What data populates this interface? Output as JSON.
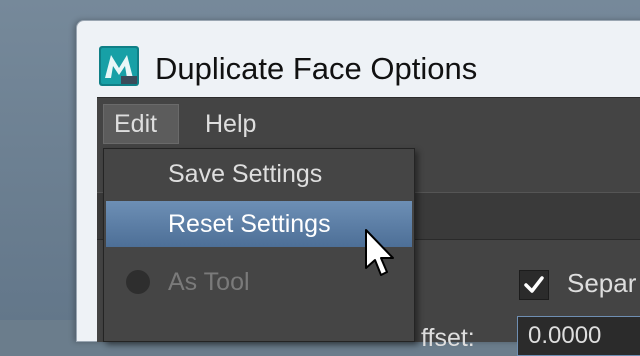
{
  "window": {
    "title": "Duplicate Face Options"
  },
  "menubar": {
    "items": [
      {
        "label": "Edit"
      },
      {
        "label": "Help"
      }
    ]
  },
  "edit_menu": {
    "items": [
      {
        "label": "Save Settings",
        "state": "normal"
      },
      {
        "label": "Reset Settings",
        "state": "highlighted"
      },
      {
        "label": "As Tool",
        "state": "disabled"
      }
    ]
  },
  "options": {
    "separate_label": "Separ",
    "separate_checked": true,
    "offset_label": "ffset:",
    "offset_value": "0.0000"
  },
  "icons": {
    "app": "maya-app-icon",
    "cursor": "arrow-cursor-icon",
    "check": "check-icon",
    "radio": "radio-icon"
  },
  "colors": {
    "menu_highlight": "#5a7ca3",
    "panel_bg": "#444444",
    "text": "#dedede",
    "disabled_text": "#7a7a7a"
  }
}
